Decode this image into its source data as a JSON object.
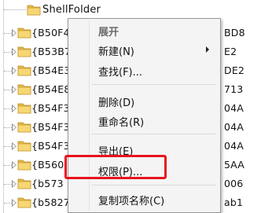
{
  "tree": {
    "top_item": "ShellFolder",
    "keys": [
      {
        "label": "{B50F4",
        "tail": "BD8"
      },
      {
        "label": "{B53B7",
        "tail": "E2"
      },
      {
        "label": "{B54E3",
        "tail": "DE2"
      },
      {
        "label": "{B54E8",
        "tail": "713"
      },
      {
        "label": "{B54F3",
        "tail": "04A"
      },
      {
        "label": "{B54F3",
        "tail": "04A"
      },
      {
        "label": "{B54F3",
        "tail": "04A"
      },
      {
        "label": "{B560",
        "tail": "5AA"
      },
      {
        "label": "{b573",
        "tail": "006"
      },
      {
        "label": "{b5827",
        "tail": "ab1"
      }
    ]
  },
  "context_menu": {
    "expand": "展开",
    "new": "新建(N)",
    "find": "查找(F)...",
    "delete": "删除(D)",
    "rename": "重命名(R)",
    "export": "导出(E)",
    "permissions": "权限(P)...",
    "copy_key_name": "复制项名称(C)"
  },
  "colors": {
    "highlight_box": "#e8141c",
    "folder_yellow": "#f0c95a",
    "menu_background": "#f4f4f4"
  }
}
